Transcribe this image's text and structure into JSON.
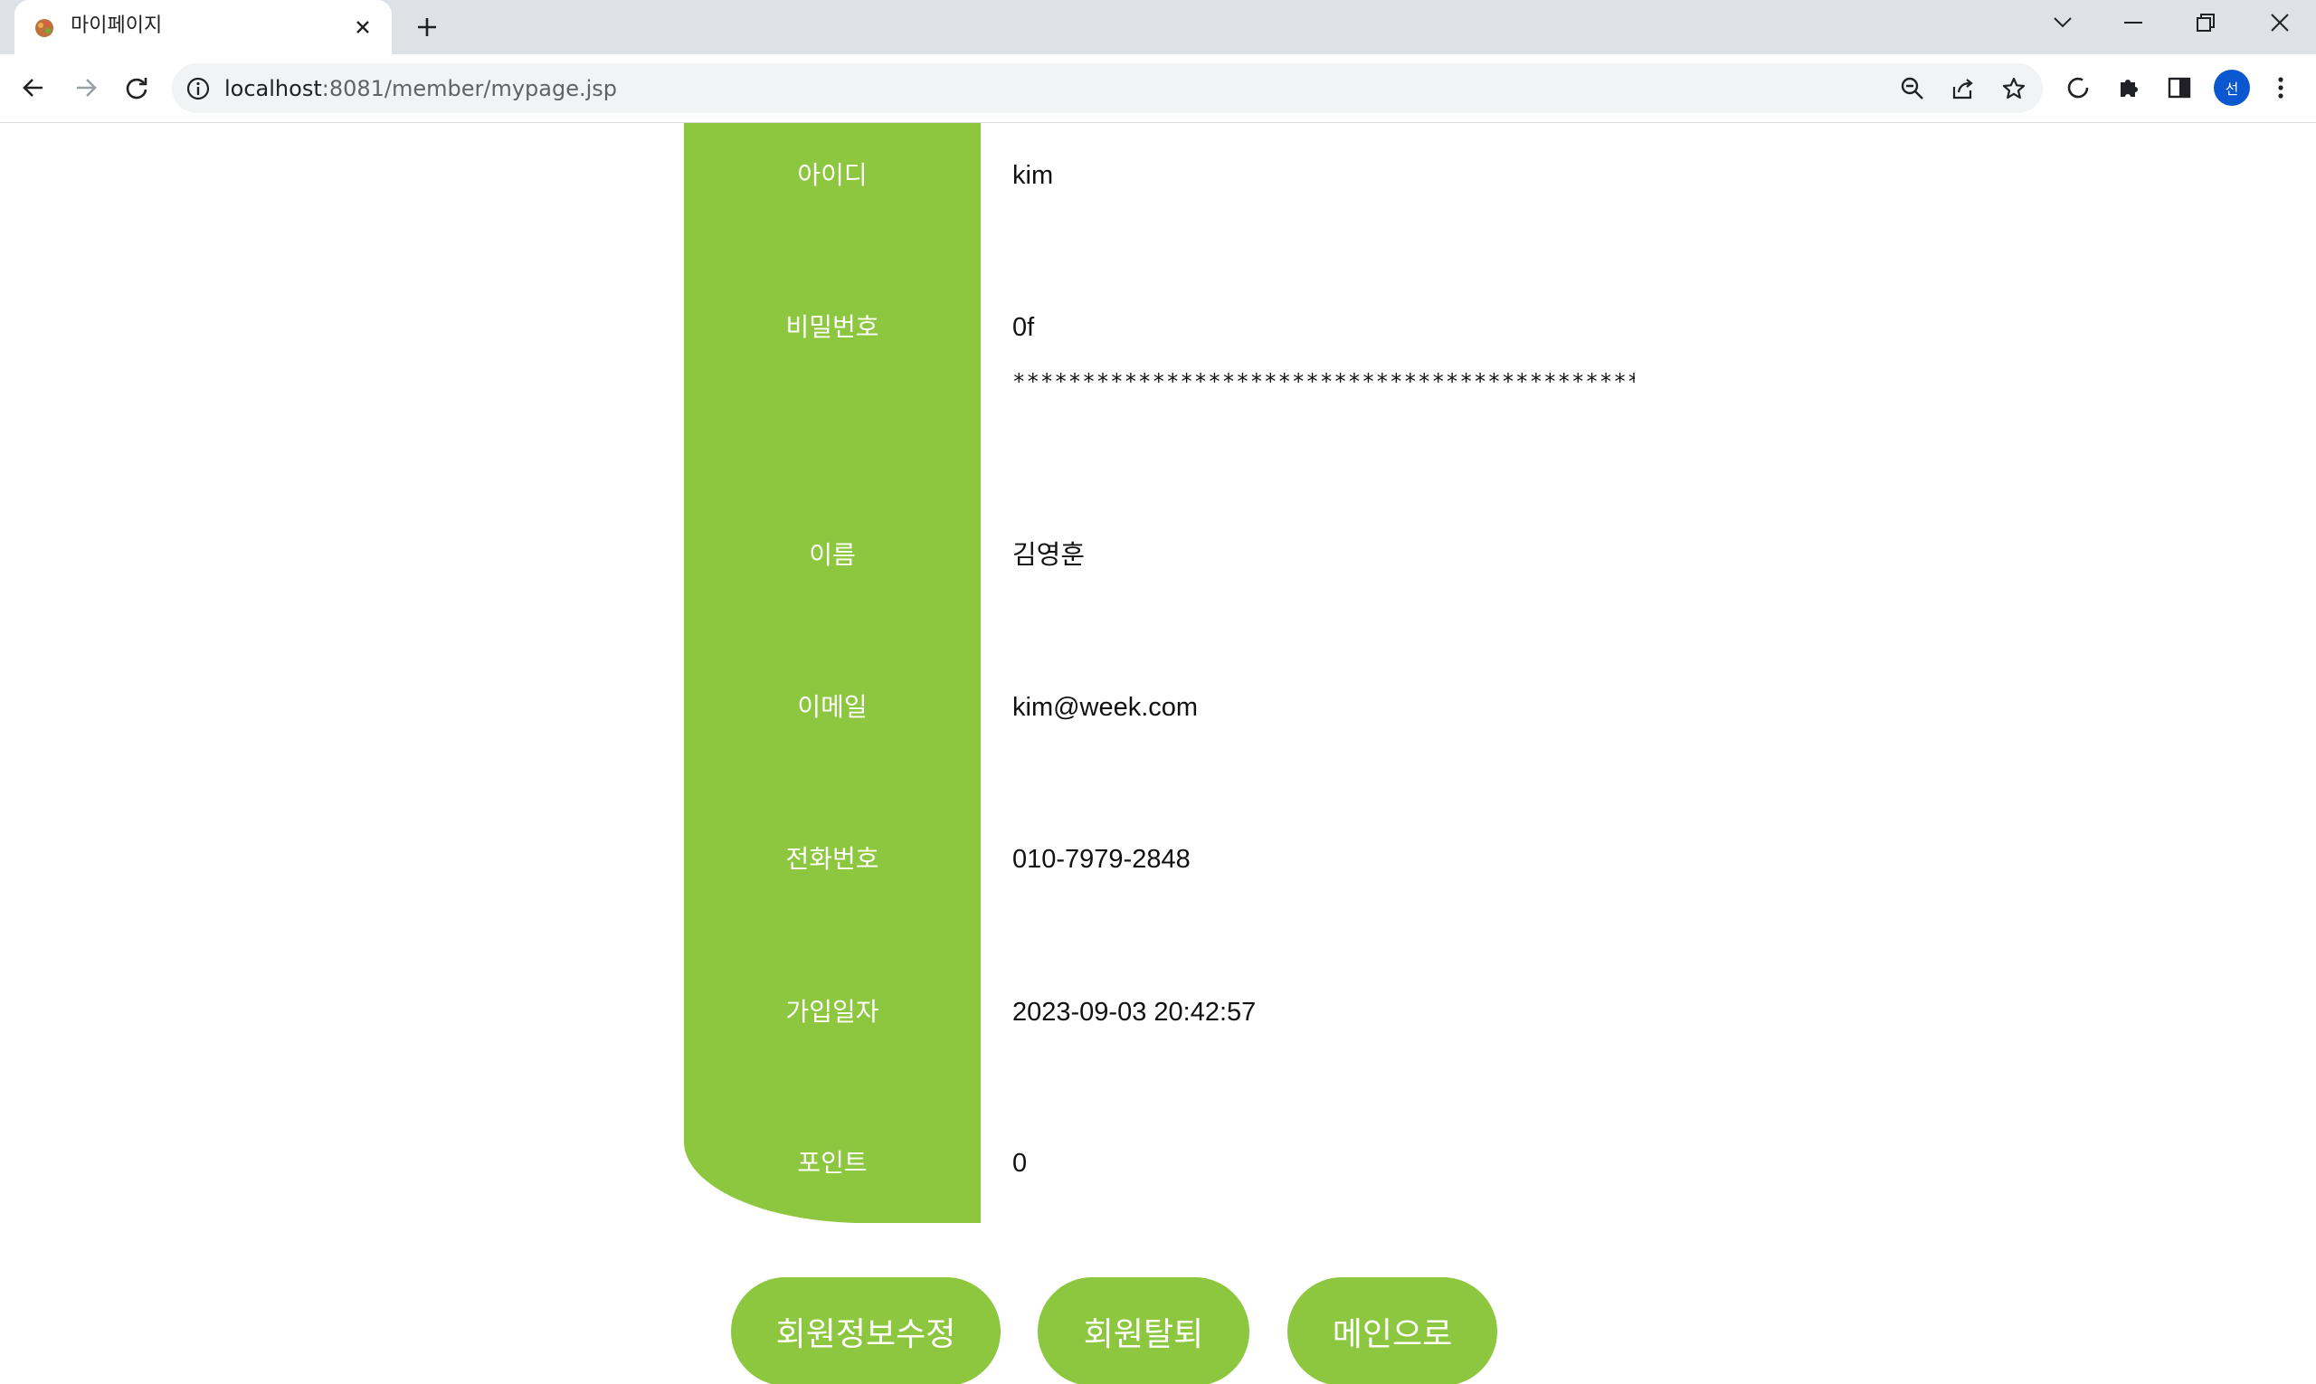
{
  "browser": {
    "tab_title": "마이페이지",
    "url_host": "localhost",
    "url_path": ":8081/member/mypage.jsp",
    "profile_initial": "선"
  },
  "fields": [
    {
      "label": "아이디",
      "value": "kim"
    },
    {
      "label": "비밀번호",
      "value": "0f",
      "masked": "***********************************************************************"
    },
    {
      "label": "이름",
      "value": "김영훈"
    },
    {
      "label": "이메일",
      "value": "kim@week.com"
    },
    {
      "label": "전화번호",
      "value": "010-7979-2848"
    },
    {
      "label": "가입일자",
      "value": "2023-09-03 20:42:57"
    },
    {
      "label": "포인트",
      "value": "0"
    }
  ],
  "buttons": {
    "edit": "회원정보수정",
    "withdraw": "회원탈퇴",
    "main": "메인으로"
  },
  "colors": {
    "accent": "#8dc63f",
    "chrome": "#dee1e6"
  }
}
